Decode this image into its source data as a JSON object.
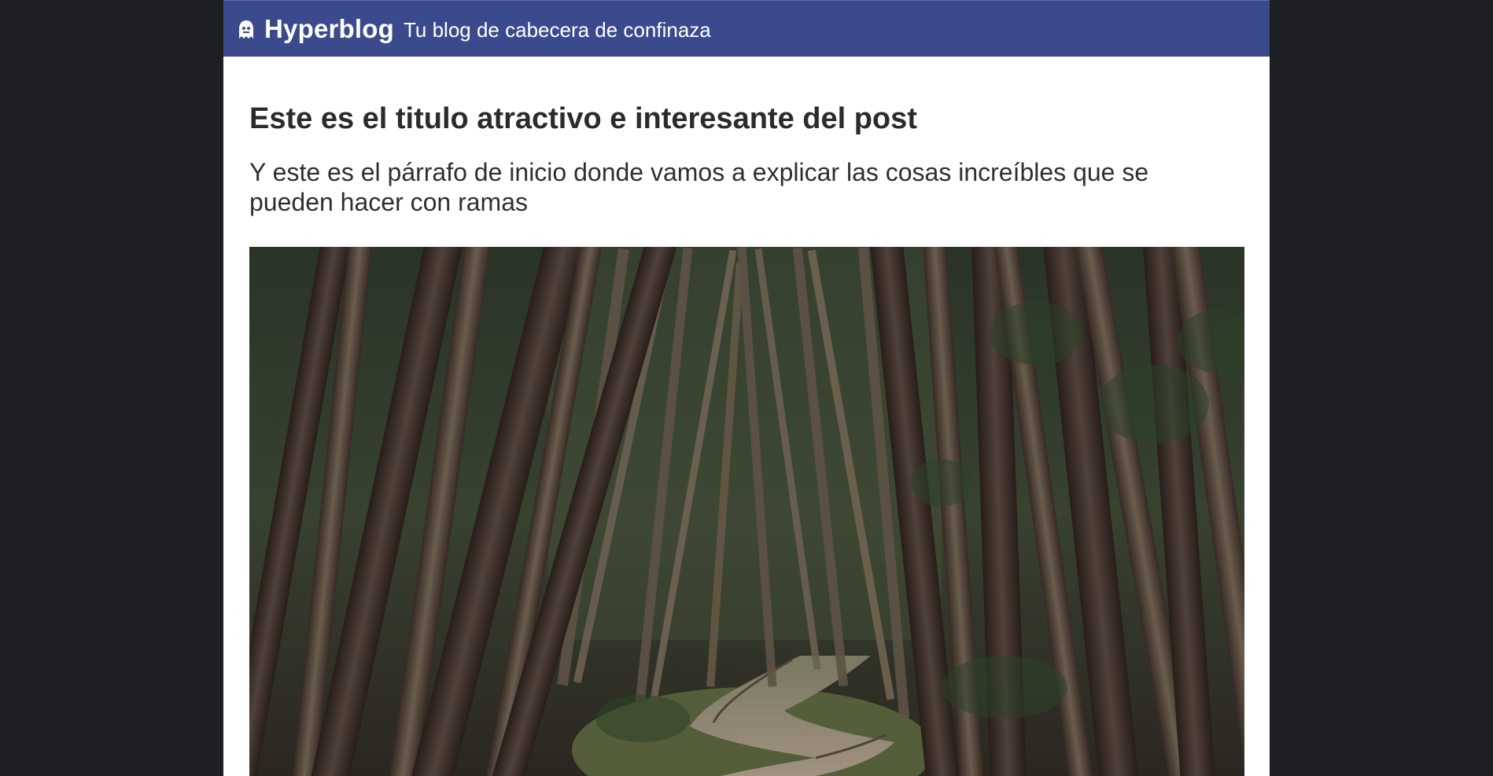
{
  "header": {
    "brand": "Hyperblog",
    "tagline": "Tu blog de cabecera de confinaza",
    "logo_icon": "ghost-icon"
  },
  "post": {
    "title": "Este es el titulo atractivo e interesante del post",
    "lead": "Y este es el párrafo de inicio donde vamos a explicar las cosas increíbles que se pueden hacer con ramas",
    "image_subject": "forest-path-photo"
  },
  "colors": {
    "background": "#1d1f23",
    "header": "#3a4a8c",
    "page": "#ffffff",
    "text": "#2b2b2b"
  }
}
